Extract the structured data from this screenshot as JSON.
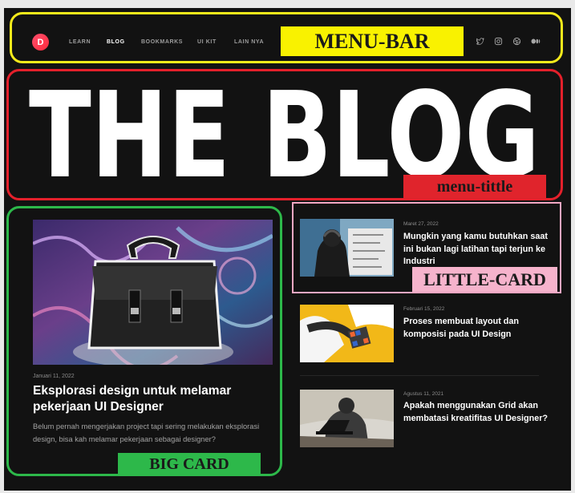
{
  "nav": {
    "logo_letter": "D",
    "items": [
      {
        "label": "LEARN",
        "active": false
      },
      {
        "label": "BLOG",
        "active": true
      },
      {
        "label": "BOOKMARKS",
        "active": false
      },
      {
        "label": "UI KIT",
        "active": false
      },
      {
        "label": "LAIN NYA",
        "active": false
      }
    ],
    "social_icons": [
      "twitter-icon",
      "instagram-icon",
      "dribbble-icon",
      "medium-icon"
    ]
  },
  "hero": {
    "title": "THE BLOG"
  },
  "annotations": {
    "menu_bar": "MENU-BAR",
    "menu_title": "menu-tittle",
    "big_card": "BIG CARD",
    "little_card": "LITTLE-CARD"
  },
  "big_card": {
    "date": "Januari 11, 2022",
    "title": "Eksplorasi design untuk melamar pekerjaan UI Designer",
    "description": "Belum pernah mengerjakan project tapi sering melakukan eksplorasi design, bisa kah melamar pekerjaan sebagai designer?"
  },
  "little_cards": [
    {
      "date": "Maret 27, 2022",
      "title": "Mungkin yang kamu butuhkan saat ini bukan lagi latihan tapi terjun ke Industri"
    },
    {
      "date": "Februari 15, 2022",
      "title": "Proses membuat layout dan komposisi pada UI Design"
    },
    {
      "date": "Agustus 11, 2021",
      "title": "Apakah menggunakan Grid akan membatasi kreatifitas UI Designer?"
    }
  ],
  "colors": {
    "background": "#121212",
    "menu_outline": "#f5ea1b",
    "title_outline": "#e4202b",
    "big_outline": "#2db84a",
    "little_outline": "#f1a7c3",
    "logo_gradient": "#ff4f6d"
  }
}
